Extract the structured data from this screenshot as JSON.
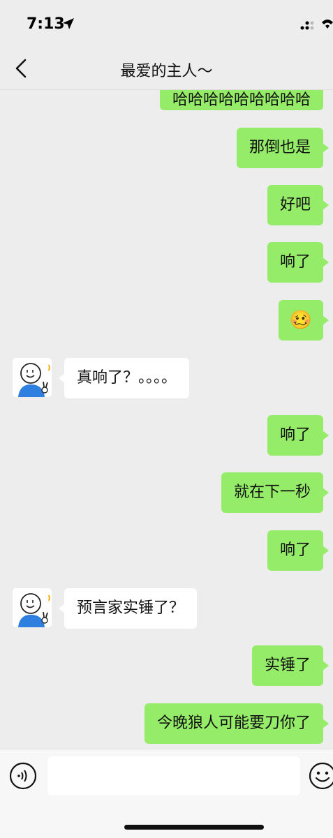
{
  "status_bar": {
    "time": "7:13"
  },
  "header": {
    "title": "最爱的主人～"
  },
  "messages": [
    {
      "side": "out",
      "text": "哈哈哈哈哈哈哈哈哈"
    },
    {
      "side": "out",
      "text": "那倒也是"
    },
    {
      "side": "out",
      "text": "好吧"
    },
    {
      "side": "out",
      "text": "响了"
    },
    {
      "side": "out",
      "emoji": "🥴"
    },
    {
      "side": "in",
      "text": "真响了？。。。。"
    },
    {
      "side": "out",
      "text": "响了"
    },
    {
      "side": "out",
      "text": "就在下一秒"
    },
    {
      "side": "out",
      "text": "响了"
    },
    {
      "side": "in",
      "text": "预言家实锤了？"
    },
    {
      "side": "out",
      "text": "实锤了"
    },
    {
      "side": "out",
      "text": "今晚狼人可能要刀你了"
    }
  ],
  "colors": {
    "outgoing": "#95ec69",
    "incoming": "#ffffff",
    "background": "#ededed"
  },
  "input_bar": {
    "value": "",
    "icons": [
      "voice-icon",
      "emoji-icon"
    ]
  }
}
